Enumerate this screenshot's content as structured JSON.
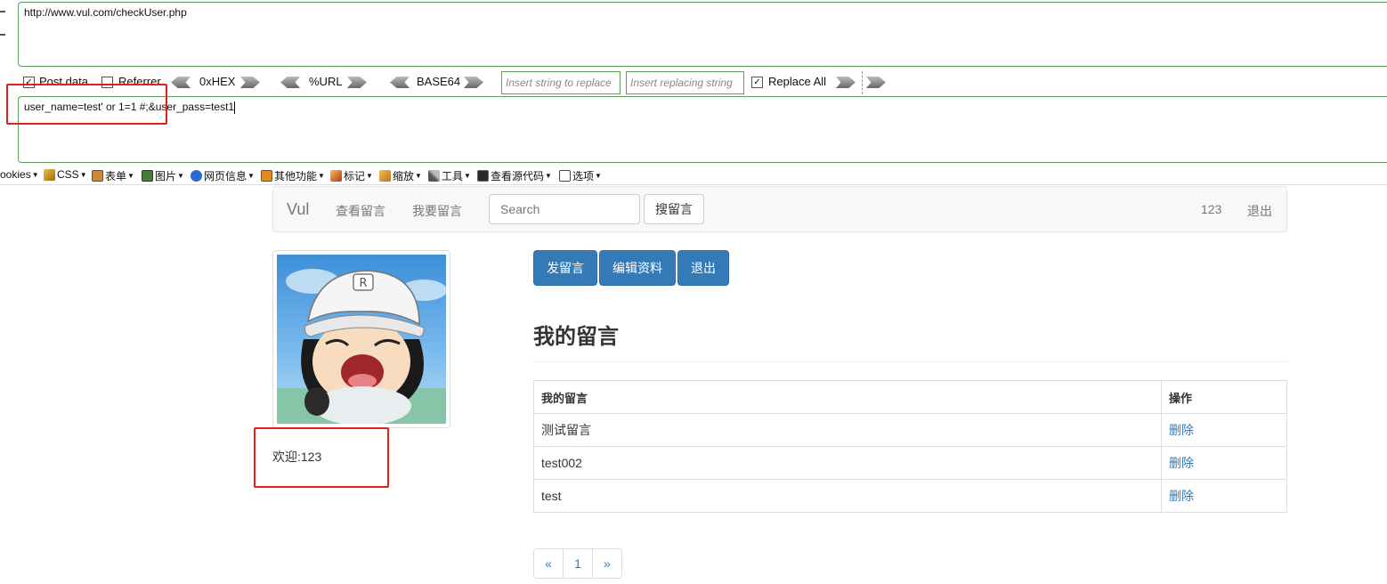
{
  "hackbar": {
    "url": "http://www.vul.com/checkUser.php",
    "post_data_label": "Post data",
    "referrer_label": "Referrer",
    "hex_label": "0xHEX",
    "url_enc_label": "%URL",
    "base64_label": "BASE64",
    "insert_placeholder": "Insert string to replace",
    "replacing_placeholder": "Insert replacing string",
    "replace_all_label": "Replace All",
    "post_body": "user_name=test' or 1=1 #;&user_pass=test1"
  },
  "devbar": {
    "items": [
      "ookies",
      "CSS",
      "表单",
      "图片",
      "网页信息",
      "其他功能",
      "标记",
      "缩放",
      "工具",
      "查看源代码",
      "选项"
    ]
  },
  "navbar": {
    "brand": "Vul",
    "link_view": "查看留言",
    "link_post": "我要留言",
    "search_placeholder": "Search",
    "search_button": "搜留言",
    "username": "123",
    "logout": "退出"
  },
  "profile": {
    "welcome": "欢迎:123"
  },
  "actions": {
    "post_msg": "发留言",
    "edit_profile": "编辑资料",
    "logout": "退出"
  },
  "messages": {
    "heading": "我的留言",
    "col_msg": "我的留言",
    "col_op": "操作",
    "rows": [
      {
        "text": "测试留言",
        "action": "删除"
      },
      {
        "text": "test002",
        "action": "删除"
      },
      {
        "text": "test",
        "action": "删除"
      }
    ]
  },
  "pagination": {
    "prev": "«",
    "page": "1",
    "next": "»"
  },
  "colors": {
    "primary": "#337ab7",
    "highlight_red": "#e02020",
    "hackbar_border": "#5aa05a"
  }
}
